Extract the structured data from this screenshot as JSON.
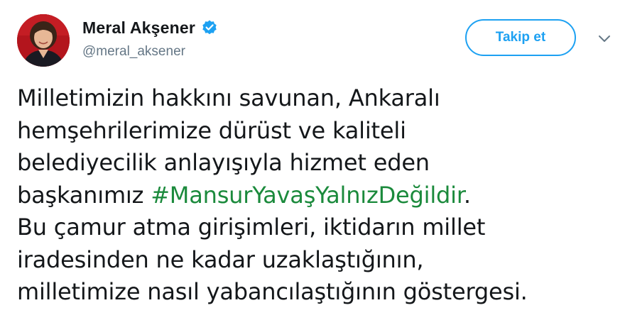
{
  "author": {
    "display_name": "Meral Akşener",
    "handle": "@meral_aksener",
    "verified": true,
    "avatar_icon": "profile-photo-icon",
    "verified_icon": "verified-badge-icon"
  },
  "actions": {
    "follow_label": "Takip et",
    "more_icon": "chevron-down-icon"
  },
  "tweet": {
    "lines": [
      "Milletimizin hakkını savunan, Ankaralı",
      "hemşehrilerimize dürüst ve kaliteli",
      "belediyecilik anlayışıyla hizmet eden",
      "Bu çamur atma girişimleri, iktidarın millet",
      "iradesinden ne kadar uzaklaştığının,",
      "milletimize nasıl yabancılaştığının göstergesi."
    ],
    "line4_prefix": "başkanımız ",
    "hashtag": "#MansurYavaşYalnızDeğildir",
    "line4_suffix": "."
  },
  "colors": {
    "follow_accent": "#1da1f2",
    "hashtag": "#1b8a3c",
    "verified_badge": "#1da1f2",
    "handle_gray": "#657786",
    "text": "#14171a"
  }
}
